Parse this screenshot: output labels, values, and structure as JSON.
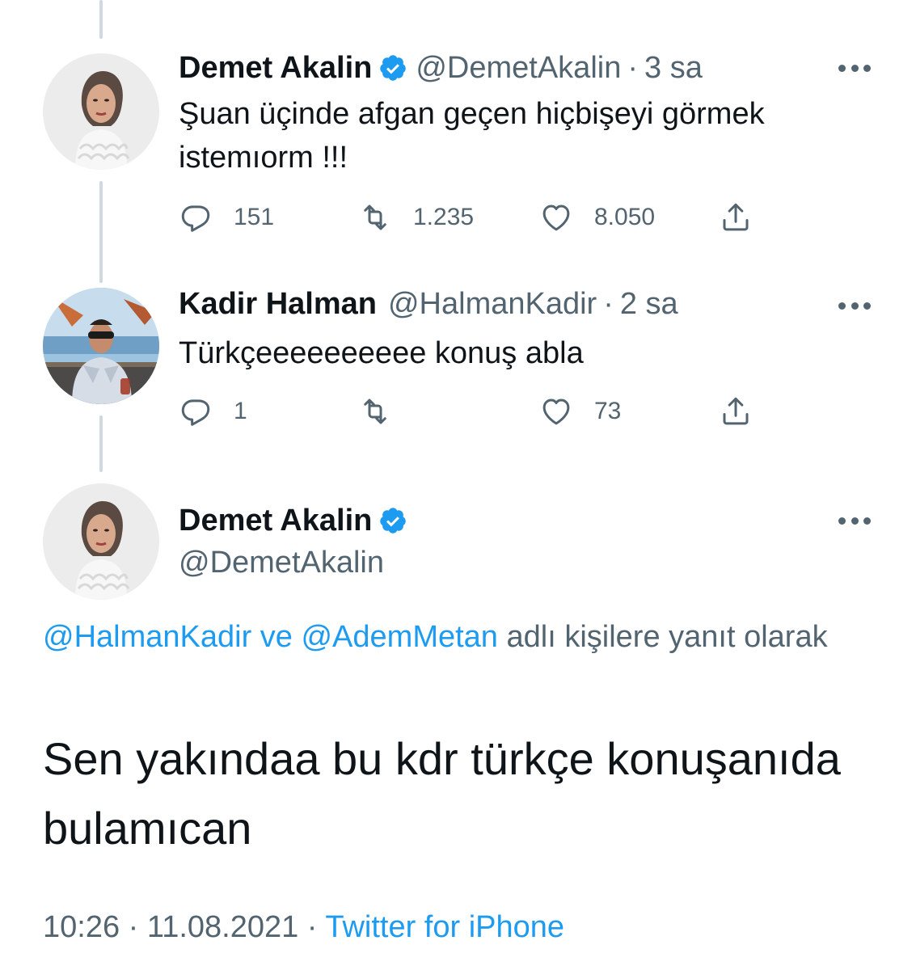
{
  "tweets": [
    {
      "name": "Demet Akalin",
      "verified": true,
      "handle": "@DemetAkalin",
      "separator": "·",
      "time": "3 sa",
      "text": "Şuan üçinde afgan geçen hiçbişeyi görmek istemıorm !!!",
      "replies": "151",
      "retweets": "1.235",
      "likes": "8.050"
    },
    {
      "name": "Kadir Halman",
      "verified": false,
      "handle": "@HalmanKadir",
      "separator": "·",
      "time": "2 sa",
      "text": "Türkçeeeeeeeeee konuş abla",
      "replies": "1",
      "retweets": "",
      "likes": "73"
    }
  ],
  "main_tweet": {
    "name": "Demet Akalin",
    "verified": true,
    "handle": "@DemetAkalin",
    "reply_to_1": "@HalmanKadir",
    "reply_to_and": " ve ",
    "reply_to_2": "@AdemMetan",
    "reply_suffix": " adlı kişilere yanıt olarak",
    "text": "Sen yakındaa bu kdr türkçe konuşanıda bulamıcan",
    "time": "10:26",
    "separator_1": " · ",
    "date": "11.08.2021",
    "separator_2": " · ",
    "source": "Twitter for iPhone"
  },
  "colors": {
    "accent": "#1d9bf0",
    "secondary_text": "#536471",
    "primary_text": "#0f1419",
    "thread_line": "#cfd9de"
  },
  "icons": {
    "reply": "reply-icon",
    "retweet": "retweet-icon",
    "like": "heart-icon",
    "share": "share-icon",
    "verified": "verified-badge-icon",
    "more": "more-icon"
  }
}
